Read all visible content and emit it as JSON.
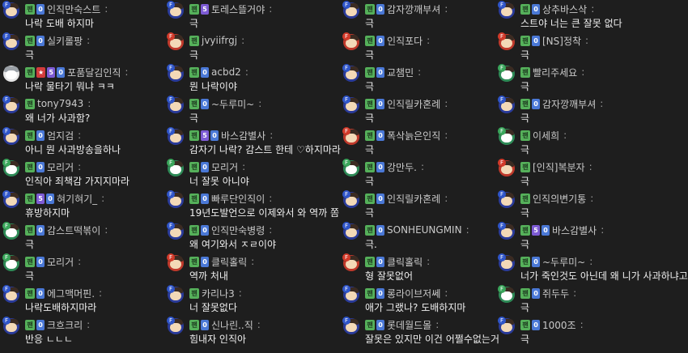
{
  "badges": {
    "fan": "팬",
    "colon": ":"
  },
  "columns": [
    {
      "messages": [
        {
          "avatar": "blue",
          "mark": "F",
          "badges": [
            "lvl"
          ],
          "nick": "인직만숙스트",
          "text": "나락 도배 하지마"
        },
        {
          "avatar": "blue",
          "mark": "F",
          "badges": [
            "lvl"
          ],
          "nick": "실키롤팡",
          "text": "극"
        },
        {
          "avatar": "white",
          "mark": "",
          "badges": [
            "star",
            "sub",
            "lvl"
          ],
          "nick": "포품달김인직",
          "text": "나락 물타기 뭐냐 ㅋㅋ"
        },
        {
          "avatar": "blue",
          "mark": "F",
          "badges": [],
          "nick": "tony7943",
          "text": "왜 너가 사과함?"
        },
        {
          "avatar": "blue",
          "mark": "F",
          "badges": [
            "lvl"
          ],
          "nick": "엄지검",
          "text": "아니 뭔 사과방송을하나"
        },
        {
          "avatar": "green",
          "mark": "F",
          "badges": [
            "lvl"
          ],
          "nick": "모리거",
          "text": "인직아 죄책감 가지지마라"
        },
        {
          "avatar": "blue",
          "mark": "F",
          "badges": [
            "sub",
            "lvl"
          ],
          "nick": "혀기혀기_",
          "text": "휴방하지마"
        },
        {
          "avatar": "green",
          "mark": "F",
          "badges": [
            "lvl"
          ],
          "nick": "감스트떡볶이",
          "text": "극"
        },
        {
          "avatar": "green",
          "mark": "F",
          "badges": [
            "lvl"
          ],
          "nick": "모리거",
          "text": "극"
        },
        {
          "avatar": "blue",
          "mark": "F",
          "badges": [
            "lvl"
          ],
          "nick": "에그맥머핀.",
          "text": "나락도배하지마라"
        },
        {
          "avatar": "blue",
          "mark": "F",
          "badges": [
            "lvl"
          ],
          "nick": "크흐크리",
          "text": "반응 ㄴㄴㄴ"
        }
      ]
    },
    {
      "messages": [
        {
          "avatar": "blue",
          "mark": "F",
          "badges": [
            "sub"
          ],
          "nick": "토레스뜰거야",
          "text": "극"
        },
        {
          "avatar": "red",
          "mark": "F",
          "badges": [],
          "nick": "jvyiifrgj",
          "text": "극"
        },
        {
          "avatar": "blue",
          "mark": "F",
          "badges": [
            "lvl"
          ],
          "nick": "acbd2",
          "text": "뭔 나락이야"
        },
        {
          "avatar": "blue",
          "mark": "F",
          "badges": [
            "lvl"
          ],
          "nick": "~두루미~",
          "text": "극"
        },
        {
          "avatar": "blue",
          "mark": "F",
          "badges": [
            "sub",
            "lvl"
          ],
          "nick": "바스감별사",
          "text": "감자기 나락? 감스트 한테 ♡하지마라"
        },
        {
          "avatar": "green",
          "mark": "F",
          "badges": [
            "lvl"
          ],
          "nick": "모리거",
          "text": "너 잘못 아니야"
        },
        {
          "avatar": "blue",
          "mark": "F",
          "badges": [
            "lvl"
          ],
          "nick": "빠루단인직이",
          "text": "19년도발언으로 이제와서 와 역까 쫌"
        },
        {
          "avatar": "blue",
          "mark": "F",
          "badges": [
            "lvl"
          ],
          "nick": "인직만숙병령",
          "text": "왜 여기와서 ㅈㄹ이야"
        },
        {
          "avatar": "red",
          "mark": "F",
          "badges": [
            "lvl"
          ],
          "nick": "클릭홀릭",
          "text": "역까 처내"
        },
        {
          "avatar": "blue",
          "mark": "F",
          "badges": [],
          "nick": "카리나3",
          "text": "너 잘못없다"
        },
        {
          "avatar": "blue",
          "mark": "F",
          "badges": [
            "lvl"
          ],
          "nick": "신나린..직",
          "text": "힘내자 인직아"
        }
      ]
    },
    {
      "messages": [
        {
          "avatar": "blue",
          "mark": "F",
          "badges": [
            "lvl"
          ],
          "nick": "감자깡깨부셔",
          "text": "극"
        },
        {
          "avatar": "red",
          "mark": "F",
          "badges": [
            "lvl"
          ],
          "nick": "인직포다",
          "text": "극"
        },
        {
          "avatar": "blue",
          "mark": "F",
          "badges": [
            "lvl"
          ],
          "nick": "교챔민",
          "text": "극"
        },
        {
          "avatar": "blue",
          "mark": "F",
          "badges": [
            "lvl"
          ],
          "nick": "인직릴카혼례",
          "text": "극"
        },
        {
          "avatar": "red",
          "mark": "F",
          "badges": [
            "lvl"
          ],
          "nick": "폭삭늙은인직",
          "text": "극"
        },
        {
          "avatar": "green",
          "mark": "F",
          "badges": [
            "lvl"
          ],
          "nick": "강만두.",
          "text": "극"
        },
        {
          "avatar": "blue",
          "mark": "F",
          "badges": [
            "lvl"
          ],
          "nick": "인직릴카혼례",
          "text": "극"
        },
        {
          "avatar": "blue",
          "mark": "F",
          "badges": [
            "lvl"
          ],
          "nick": "SONHEUNGMIN",
          "text": "극."
        },
        {
          "avatar": "red",
          "mark": "F",
          "badges": [
            "lvl"
          ],
          "nick": "클릭홀릭",
          "text": "형 잘못없어"
        },
        {
          "avatar": "blue",
          "mark": "F",
          "badges": [
            "lvl"
          ],
          "nick": "롱라이브저쎄",
          "text": "애가 그랬나? 도배하지마"
        },
        {
          "avatar": "blue",
          "mark": "F",
          "badges": [
            "lvl"
          ],
          "nick": "롯데월드몰",
          "text": "잘못은 있지만 이건 어쩔수없는거"
        }
      ]
    },
    {
      "messages": [
        {
          "avatar": "blue",
          "mark": "F",
          "badges": [
            "lvl"
          ],
          "nick": "상추바스삭",
          "text": "스트야 너는 큰 잘못 없다"
        },
        {
          "avatar": "red",
          "mark": "F",
          "badges": [
            "lvl"
          ],
          "nick": "[NS]정착",
          "text": "극"
        },
        {
          "avatar": "green",
          "mark": "F",
          "badges": [],
          "nick": "빨리주세요",
          "text": "극"
        },
        {
          "avatar": "blue",
          "mark": "F",
          "badges": [
            "lvl"
          ],
          "nick": "감자깡깨부셔",
          "text": "극"
        },
        {
          "avatar": "green",
          "mark": "F",
          "badges": [],
          "nick": "이세희",
          "text": "극"
        },
        {
          "avatar": "red",
          "mark": "F",
          "badges": [],
          "nick": "[인직]복분자",
          "text": "극"
        },
        {
          "avatar": "blue",
          "mark": "F",
          "badges": [],
          "nick": "인직의변기통",
          "text": "극"
        },
        {
          "avatar": "blue",
          "mark": "F",
          "badges": [
            "sub",
            "lvl"
          ],
          "nick": "바스감별사",
          "text": "극"
        },
        {
          "avatar": "blue",
          "mark": "F",
          "badges": [
            "lvl"
          ],
          "nick": "~두루미~",
          "text": "너가 죽인것도 아닌데 왜 니가 사과하냐고"
        },
        {
          "avatar": "green",
          "mark": "F",
          "badges": [
            "lvl"
          ],
          "nick": "쥐두두",
          "text": "극"
        },
        {
          "avatar": "blue",
          "mark": "F",
          "badges": [
            "lvl"
          ],
          "nick": "1000조",
          "text": "극"
        }
      ]
    }
  ],
  "badge_text": {
    "lvl": "0",
    "sub": "5",
    "star": "★"
  }
}
